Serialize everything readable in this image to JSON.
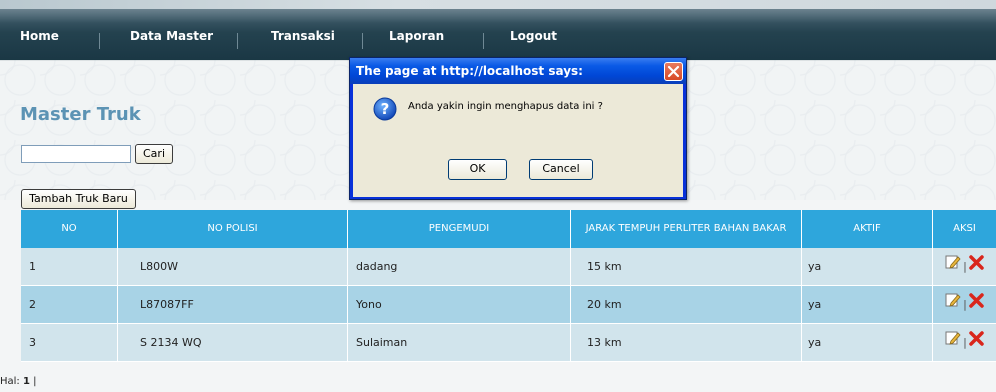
{
  "nav": {
    "items": [
      "Home",
      "Data Master",
      "Transaksi",
      "Laporan",
      "Logout"
    ]
  },
  "page": {
    "title": "Master Truk",
    "search_value": "",
    "search_button": "Cari",
    "add_button": "Tambah Truk Baru"
  },
  "table": {
    "headers": [
      "NO",
      "NO POLISI",
      "PENGEMUDI",
      "JARAK TEMPUH PERLITER BAHAN BAKAR",
      "AKTIF",
      "AKSI"
    ],
    "rows": [
      {
        "no": "1",
        "no_polisi": "L800W",
        "pengemudi": "dadang",
        "jarak": "15 km",
        "aktif": "ya"
      },
      {
        "no": "2",
        "no_polisi": "L87087FF",
        "pengemudi": "Yono",
        "jarak": "20 km",
        "aktif": "ya"
      },
      {
        "no": "3",
        "no_polisi": "S 2134 WQ",
        "pengemudi": "Sulaiman",
        "jarak": "13 km",
        "aktif": "ya"
      }
    ],
    "aksi_separator": "|"
  },
  "pagination": {
    "label": "Hal:",
    "current": "1",
    "separator": "|"
  },
  "dialog": {
    "title": "The page at http://localhost says:",
    "message": "Anda yakin ingin menghapus data ini ?",
    "ok_label": "OK",
    "cancel_label": "Cancel",
    "icon": "question-icon"
  },
  "colors": {
    "nav_bg": "#1a3744",
    "header_bg": "#2ea6dc",
    "row_light": "#d1e4ec",
    "row_dark": "#a8d3e6",
    "title": "#5c93b4",
    "dialog_title": "#0046d5"
  }
}
